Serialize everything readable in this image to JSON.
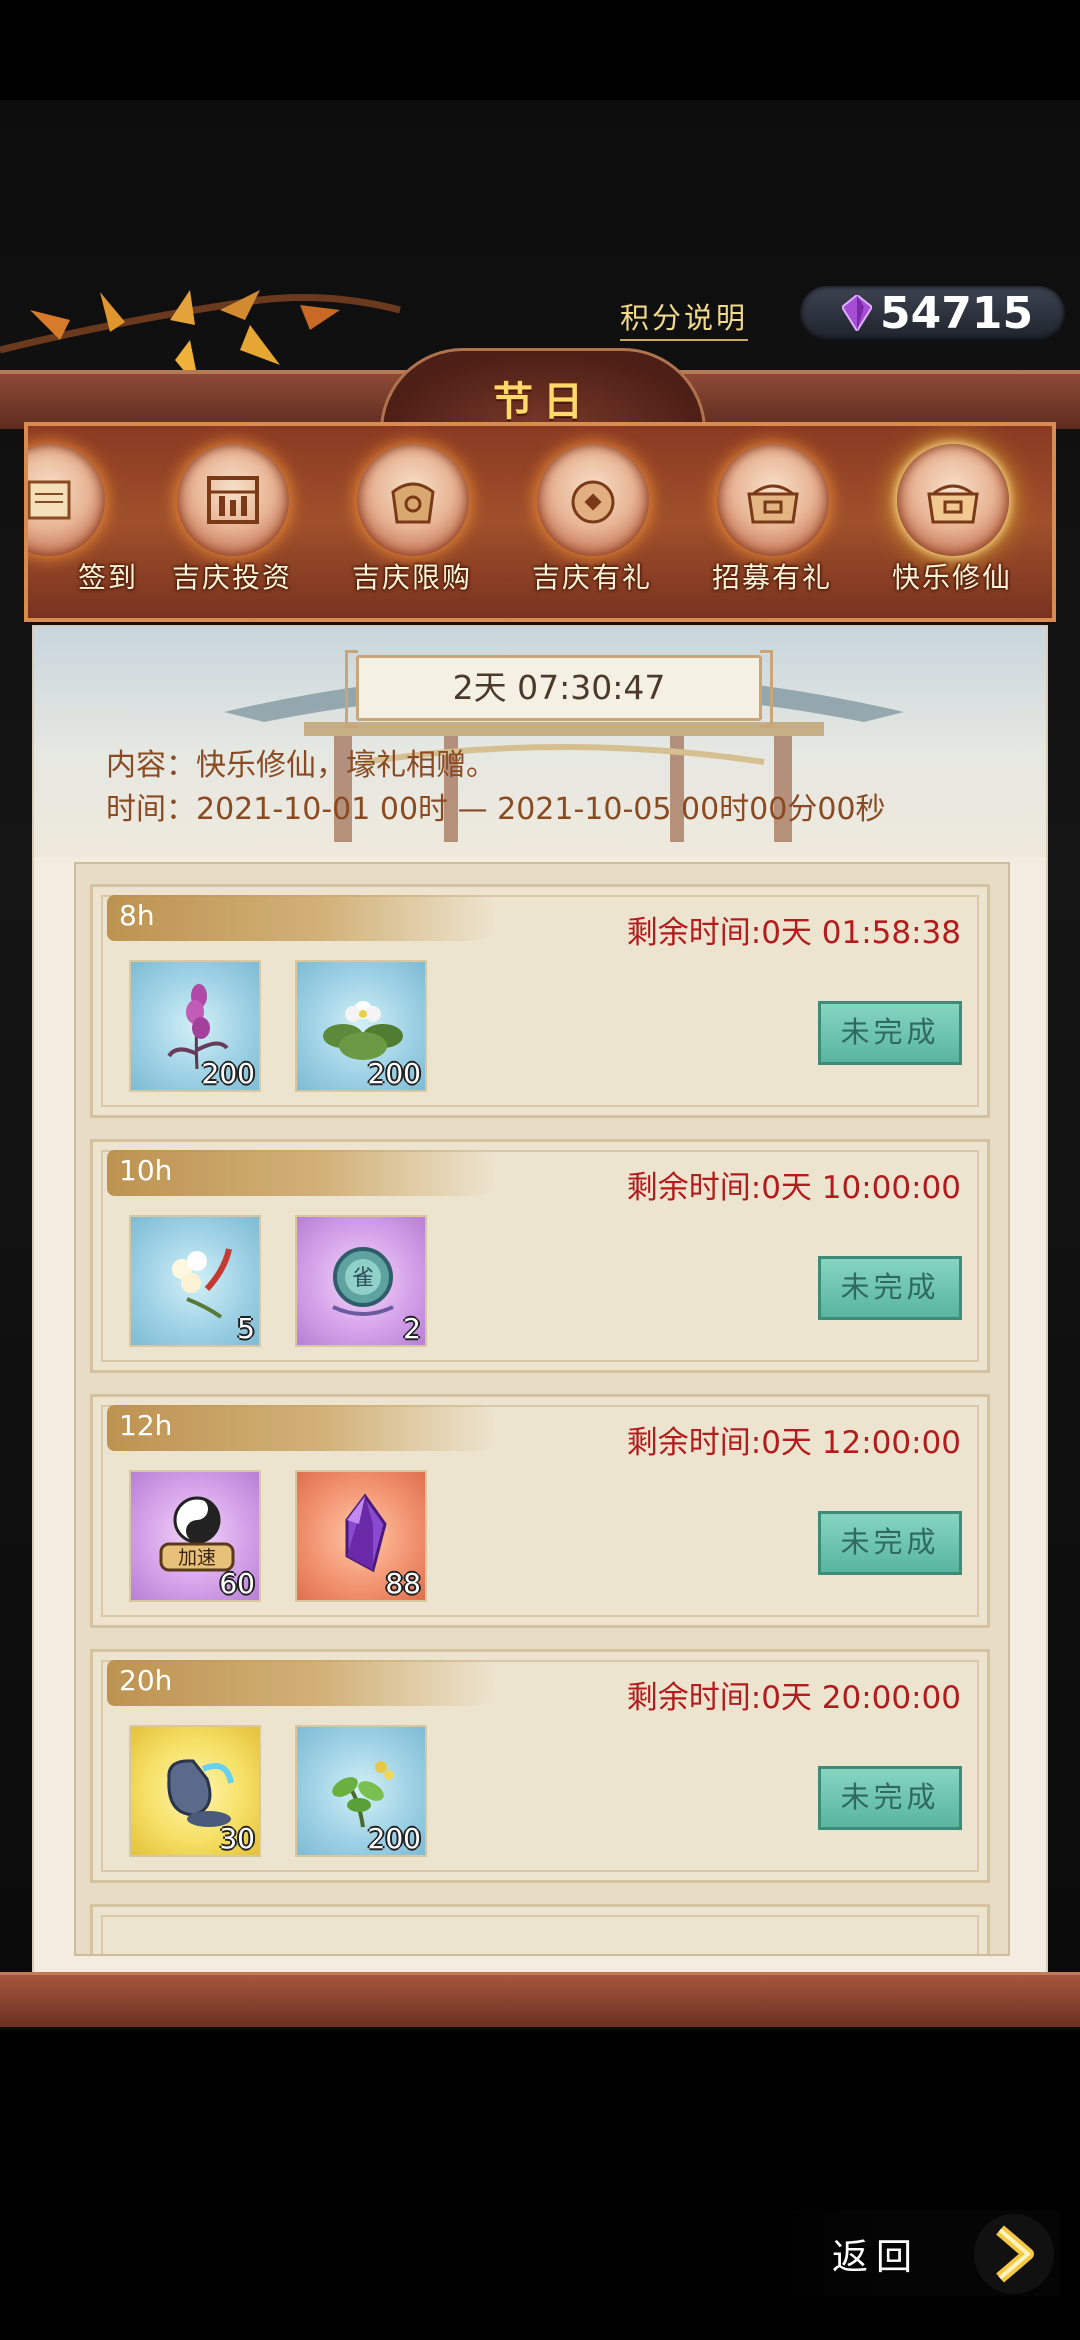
{
  "header": {
    "points_info_label": "积分说明",
    "currency_value": "54715",
    "title": "节日"
  },
  "tabs": [
    {
      "label": "签到",
      "icon": "scroll-icon"
    },
    {
      "label": "吉庆投资",
      "icon": "abacus-icon"
    },
    {
      "label": "吉庆限购",
      "icon": "gift-bag-icon"
    },
    {
      "label": "吉庆有礼",
      "icon": "coin-icon"
    },
    {
      "label": "招募有礼",
      "icon": "chest-icon"
    },
    {
      "label": "快乐修仙",
      "icon": "chest-icon",
      "active": true
    }
  ],
  "event": {
    "countdown": "2天 07:30:47",
    "content_line": "内容：快乐修仙，壕礼相赠。",
    "time_line": "时间：2021-10-01 00时 — 2021-10-05 00时00分00秒"
  },
  "tasks": [
    {
      "hours": "8h",
      "remaining": "剩余时间:0天 01:58:38",
      "status": "未完成",
      "rewards": [
        {
          "icon": "purple-herb-icon",
          "qty": "200",
          "bg": "blue"
        },
        {
          "icon": "white-flower-icon",
          "qty": "200",
          "bg": "blue"
        }
      ]
    },
    {
      "hours": "10h",
      "remaining": "剩余时间:0天 10:00:00",
      "status": "未完成",
      "rewards": [
        {
          "icon": "blossom-icon",
          "qty": "5",
          "bg": "blue"
        },
        {
          "icon": "spirit-orb-icon",
          "qty": "2",
          "bg": "purple"
        }
      ]
    },
    {
      "hours": "12h",
      "remaining": "剩余时间:0天 12:00:00",
      "status": "未完成",
      "rewards": [
        {
          "icon": "yin-yang-speedup-icon",
          "qty": "60",
          "bg": "purple",
          "badge": "加速"
        },
        {
          "icon": "purple-crystal-icon",
          "qty": "88",
          "bg": "orange"
        }
      ]
    },
    {
      "hours": "20h",
      "remaining": "剩余时间:0天 20:00:00",
      "status": "未完成",
      "rewards": [
        {
          "icon": "elixir-pot-icon",
          "qty": "30",
          "bg": "gold"
        },
        {
          "icon": "green-herb-icon",
          "qty": "200",
          "bg": "blue"
        }
      ]
    }
  ],
  "footer": {
    "back_label": "返回"
  },
  "colors": {
    "accent_gold": "#ffd96a",
    "remaining_red": "#b31c1c",
    "status_teal": "#6cc4ae",
    "tab_frame": "#a0502b"
  }
}
